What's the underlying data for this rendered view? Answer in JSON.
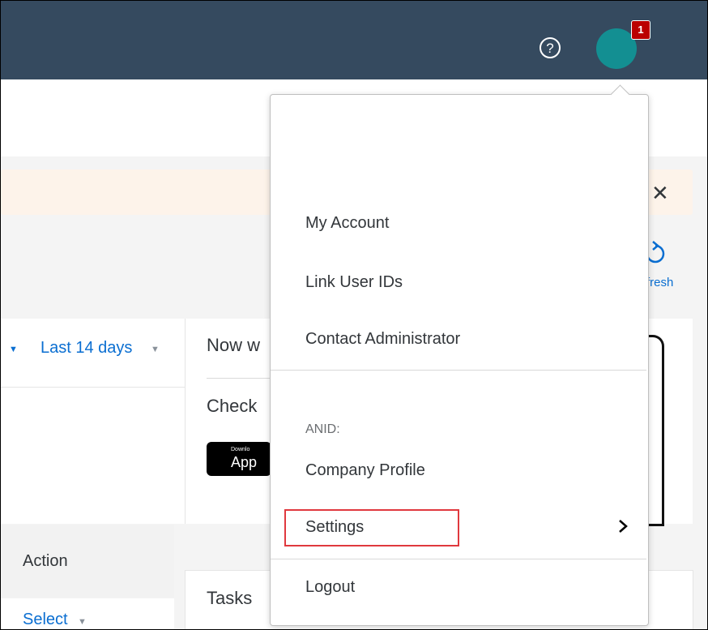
{
  "header": {
    "help_icon": "help-circle-icon",
    "avatar_color": "#138f92",
    "notification_count": "1"
  },
  "banner": {
    "close_label": "✕"
  },
  "toolbar": {
    "refresh_label": "fresh"
  },
  "filter": {
    "date_range": "Last 14 days"
  },
  "promo": {
    "title": "Now w",
    "subtitle": "Check",
    "app_badge_small": "Downlo",
    "app_badge_large": "App"
  },
  "table": {
    "action_header": "Action",
    "select_label": "Select"
  },
  "tasks": {
    "title": "Tasks"
  },
  "user_menu": {
    "items": [
      {
        "label": "My Account"
      },
      {
        "label": "Link User IDs"
      },
      {
        "label": "Contact Administrator"
      }
    ],
    "anid_label": "ANID:",
    "company_profile": "Company Profile",
    "settings": "Settings",
    "logout": "Logout"
  },
  "colors": {
    "header_bg": "#354a5f",
    "link": "#0a6ed1",
    "badge": "#bb0000",
    "highlight_border": "#e0393e"
  }
}
